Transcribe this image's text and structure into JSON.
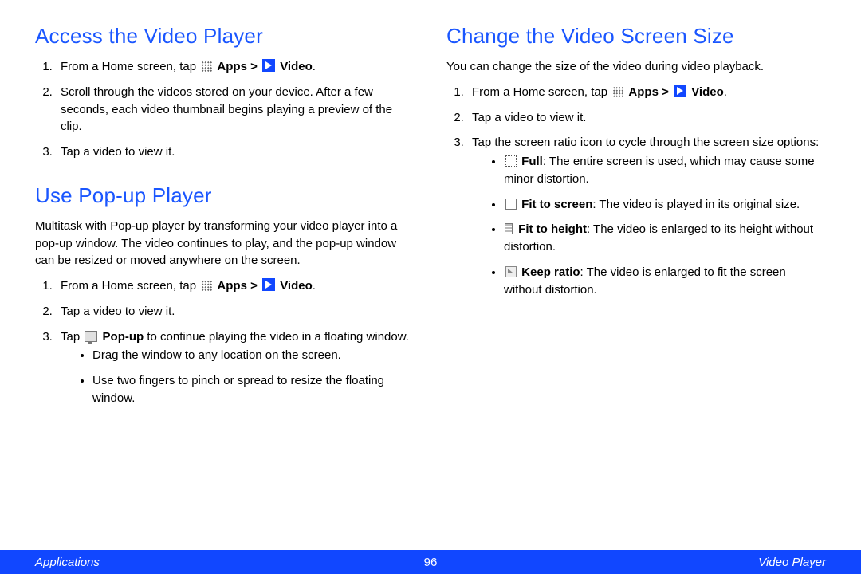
{
  "footer": {
    "left": "Applications",
    "page": "96",
    "right": "Video Player"
  },
  "left": {
    "sec1": {
      "title": "Access the Video Player",
      "i1a": "From a Home screen, tap ",
      "apps": "Apps > ",
      "video": "Video",
      "period": ".",
      "i2": "Scroll through the videos stored on your device. After a few seconds, each video thumbnail begins playing a preview of the clip.",
      "i3": "Tap a video to view it."
    },
    "sec2": {
      "title": "Use Pop-up Player",
      "intro": "Multitask with Pop-up player by transforming your video player into a pop-up window. The video continues to play, and the pop-up window can be resized or moved anywhere on the screen.",
      "i1a": "From a Home screen, tap ",
      "apps": "Apps > ",
      "video": "Video",
      "period": ".",
      "i2": "Tap a video to view it.",
      "i3a": "Tap ",
      "i3b": "Pop-up",
      "i3c": " to continue playing the video in a floating window.",
      "b1": "Drag the window to any location on the screen.",
      "b2": "Use two fingers to pinch or spread to resize the floating window."
    }
  },
  "right": {
    "sec1": {
      "title": "Change the Video Screen Size",
      "intro": "You can change the size of the video during video playback.",
      "i1a": "From a Home screen, tap ",
      "apps": "Apps > ",
      "video": "Video",
      "period": ".",
      "i2": "Tap a video to view it.",
      "i3": "Tap the screen ratio icon to cycle through the screen size options:",
      "o1a": "Full",
      "o1b": ": The entire screen is used, which may cause some minor distortion.",
      "o2a": "Fit to screen",
      "o2b": ": The video is played in its original size.",
      "o3a": "Fit to height",
      "o3b": ": The video is enlarged to its height without distortion.",
      "o4a": "Keep ratio",
      "o4b": ": The video is enlarged to fit the screen without distortion."
    }
  }
}
